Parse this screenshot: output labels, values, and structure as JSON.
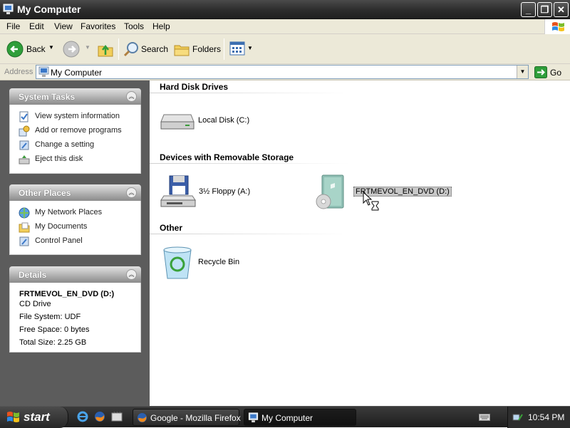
{
  "window": {
    "title": "My Computer"
  },
  "menu": [
    "File",
    "Edit",
    "View",
    "Favorites",
    "Tools",
    "Help"
  ],
  "toolbar": {
    "back_label": "Back",
    "search_label": "Search",
    "folders_label": "Folders"
  },
  "address": {
    "label": "Address",
    "value": "My Computer",
    "go_label": "Go"
  },
  "sidebar": {
    "system_tasks": {
      "title": "System Tasks",
      "items": [
        "View system information",
        "Add or remove programs",
        "Change a setting",
        "Eject this disk"
      ]
    },
    "other_places": {
      "title": "Other Places",
      "items": [
        "My Network Places",
        "My Documents",
        "Control Panel"
      ]
    },
    "details": {
      "title": "Details",
      "name": "FRTMEVOL_EN_DVD (D:)",
      "type": "CD Drive",
      "file_system": "File System: UDF",
      "free_space": "Free Space: 0 bytes",
      "total_size": "Total Size: 2.25 GB"
    }
  },
  "content": {
    "groups": [
      {
        "title": "Hard Disk Drives",
        "items": [
          "Local Disk (C:)"
        ]
      },
      {
        "title": "Devices with Removable Storage",
        "items": [
          "3½ Floppy (A:)",
          "FRTMEVOL_EN_DVD (D:)"
        ]
      },
      {
        "title": "Other",
        "items": [
          "Recycle Bin"
        ]
      }
    ]
  },
  "taskbar": {
    "start_label": "start",
    "buttons": [
      "Google - Mozilla Firefox",
      "My Computer"
    ],
    "clock": "10:54 PM"
  },
  "colors": {
    "titlebar": "#2c2c2c",
    "pane": "#5c5c5c",
    "selection": "#c8c8c8"
  }
}
